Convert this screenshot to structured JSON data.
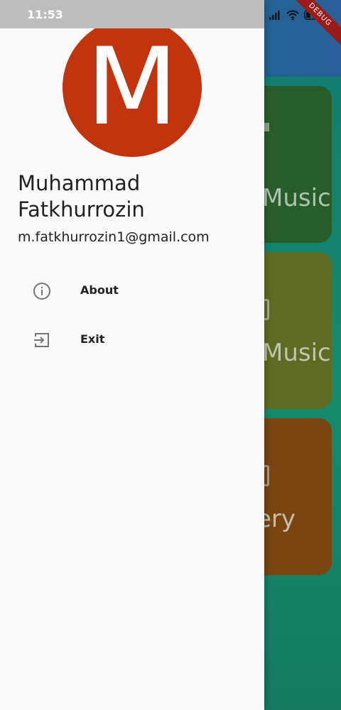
{
  "status_bar": {
    "time": "11:53",
    "battery_level": "26",
    "debug_label": "DEBUG"
  },
  "drawer": {
    "avatar_letter": "M",
    "avatar_color": "#c2340e",
    "user_name": "Muhammad Fatkhurrozin",
    "user_email": "m.fatkhurrozin1@gmail.com",
    "menu": [
      {
        "label": "About",
        "icon": "info-icon"
      },
      {
        "label": "Exit",
        "icon": "exit-icon"
      }
    ]
  },
  "background": {
    "cards": [
      {
        "label": "Music",
        "color": "#275d2b"
      },
      {
        "label": "Music",
        "color": "#5f6a22"
      },
      {
        "label": "ery",
        "color": "#7a4510"
      }
    ]
  }
}
